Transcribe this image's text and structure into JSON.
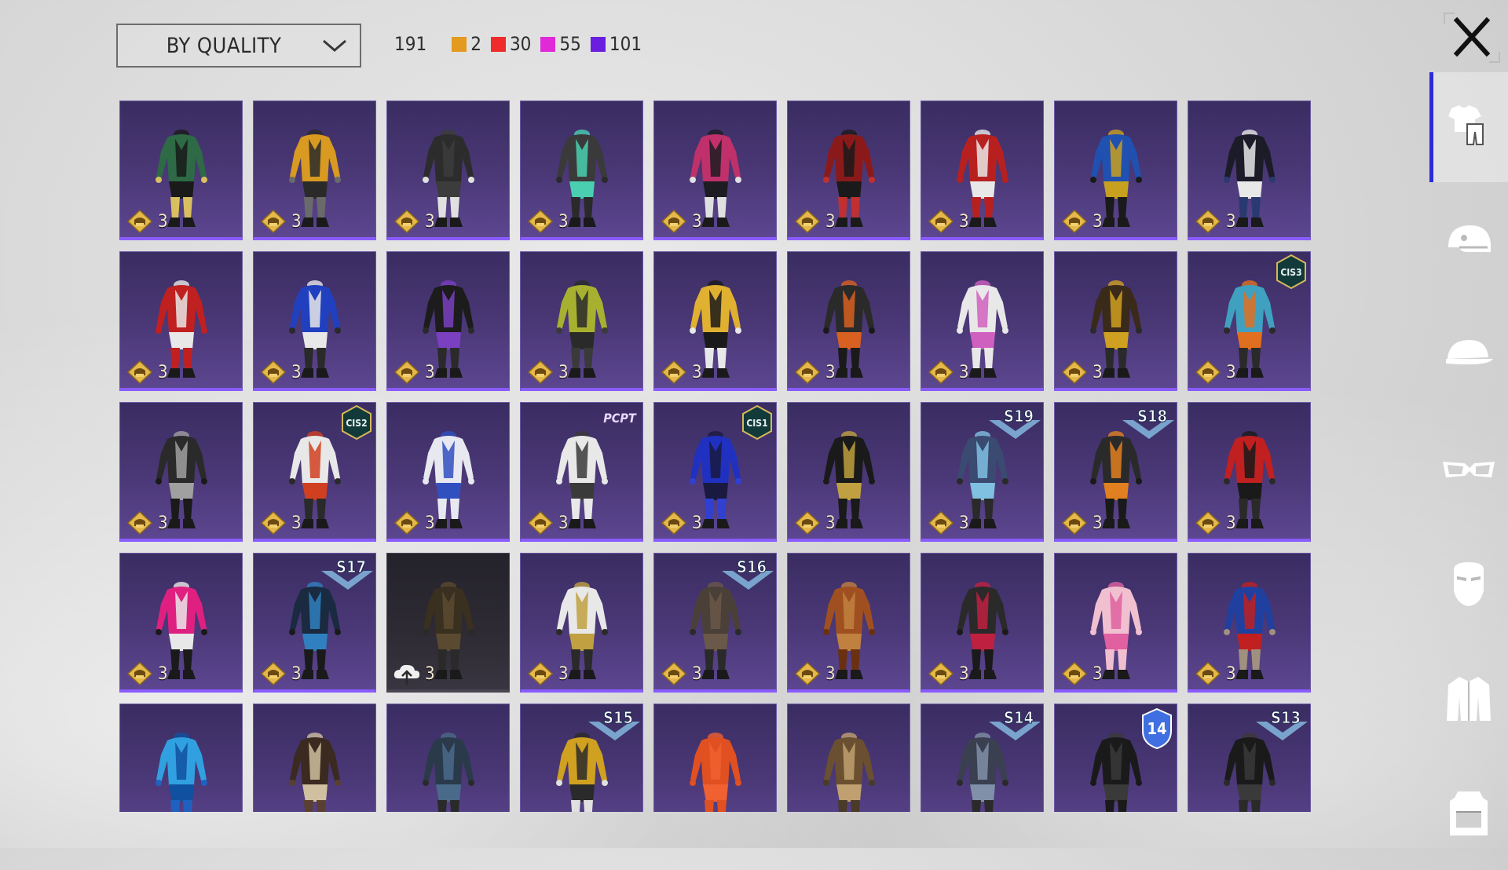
{
  "sort": {
    "label": "BY QUALITY",
    "icon": "chevron-down-icon"
  },
  "counts": {
    "total": "191",
    "groups": [
      {
        "color": "#e39a1e",
        "count": "2"
      },
      {
        "color": "#ef2b2b",
        "count": "30"
      },
      {
        "color": "#e02ad8",
        "count": "55"
      },
      {
        "color": "#6a1ee0",
        "count": "101"
      }
    ]
  },
  "close": {
    "icon": "close-icon"
  },
  "sidebar": [
    {
      "icon": "outfit-icon",
      "active": true
    },
    {
      "icon": "helmet-icon"
    },
    {
      "icon": "cap-icon"
    },
    {
      "icon": "goggles-icon"
    },
    {
      "icon": "mask-icon"
    },
    {
      "icon": "jacket-icon"
    },
    {
      "icon": "backpack-icon"
    }
  ],
  "items": [
    {
      "qty": "3",
      "palette": [
        "#2d6a45",
        "#1a1a1a",
        "#d8c060"
      ]
    },
    {
      "qty": "3",
      "palette": [
        "#d89a20",
        "#2a2a2a",
        "#6a6a6a"
      ]
    },
    {
      "qty": "3",
      "palette": [
        "#2c2c2c",
        "#3c3c3c",
        "#e0e0e0"
      ]
    },
    {
      "qty": "3",
      "palette": [
        "#3a3a3a",
        "#4ad0b0",
        "#2a2a2a"
      ]
    },
    {
      "qty": "3",
      "palette": [
        "#c0306a",
        "#1c1c22",
        "#e0e0e0"
      ]
    },
    {
      "qty": "3",
      "palette": [
        "#8a1a1a",
        "#1a1a1a",
        "#c03030"
      ]
    },
    {
      "qty": "3",
      "palette": [
        "#b82020",
        "#e8e8e8",
        "#b82020"
      ]
    },
    {
      "qty": "3",
      "palette": [
        "#2050b0",
        "#c8a020",
        "#1a1a1a"
      ]
    },
    {
      "qty": "3",
      "palette": [
        "#1c1c28",
        "#e8e8e8",
        "#2a3a70"
      ]
    },
    {
      "qty": "3",
      "palette": [
        "#c02020",
        "#e8e8e8",
        "#c02020"
      ]
    },
    {
      "qty": "3",
      "palette": [
        "#2040c0",
        "#e8e8e8",
        "#2a2a2a"
      ]
    },
    {
      "qty": "3",
      "palette": [
        "#1c1c1c",
        "#7a40c0",
        "#2a2a2a"
      ]
    },
    {
      "qty": "3",
      "palette": [
        "#a8b030",
        "#2a2a2a",
        "#3a3a3a"
      ]
    },
    {
      "qty": "3",
      "palette": [
        "#e0b030",
        "#1a1a1a",
        "#e8e8e8"
      ]
    },
    {
      "qty": "3",
      "palette": [
        "#2a2a2a",
        "#d86020",
        "#1a1a1a"
      ]
    },
    {
      "qty": "3",
      "palette": [
        "#e8e8e8",
        "#d060c0",
        "#e8e8e8"
      ]
    },
    {
      "qty": "3",
      "palette": [
        "#3a2a1a",
        "#d0a020",
        "#2a2a2a"
      ]
    },
    {
      "qty": "3",
      "palette": [
        "#40a0c0",
        "#e07020",
        "#2a2a2a"
      ],
      "badge": {
        "type": "hex",
        "text": "CIS3"
      }
    },
    {
      "qty": "3",
      "palette": [
        "#2a2a2a",
        "#a0a0a0",
        "#1a1a1a"
      ]
    },
    {
      "qty": "3",
      "palette": [
        "#e8e8e8",
        "#d04020",
        "#2a2a2a"
      ],
      "badge": {
        "type": "hex",
        "text": "CIS2"
      }
    },
    {
      "qty": "3",
      "palette": [
        "#e8e8f0",
        "#3050c0",
        "#e8e8f0"
      ]
    },
    {
      "qty": "3",
      "palette": [
        "#e8e8e8",
        "#3a3a3a",
        "#e8e8e8"
      ],
      "badge": {
        "type": "logo",
        "text": "PCPT"
      }
    },
    {
      "qty": "3",
      "palette": [
        "#2030c0",
        "#1a1a40",
        "#3040d0"
      ],
      "badge": {
        "type": "hex",
        "text": "CIS1"
      }
    },
    {
      "qty": "3",
      "palette": [
        "#1a1a1a",
        "#c0a040",
        "#1a1a1a"
      ]
    },
    {
      "qty": "3",
      "palette": [
        "#3a4a70",
        "#80c0e0",
        "#2a2a2a"
      ],
      "badge": {
        "type": "season",
        "text": "S19"
      }
    },
    {
      "qty": "3",
      "palette": [
        "#2a2a2a",
        "#e08020",
        "#1a1a1a"
      ],
      "badge": {
        "type": "season",
        "text": "S18"
      }
    },
    {
      "qty": "3",
      "palette": [
        "#c02020",
        "#1a1a1a",
        "#2a2a2a"
      ]
    },
    {
      "qty": "3",
      "palette": [
        "#e02080",
        "#e8e8e8",
        "#1a1a1a"
      ]
    },
    {
      "qty": "3",
      "palette": [
        "#1a2a40",
        "#3080c0",
        "#1a1a1a"
      ],
      "badge": {
        "type": "season",
        "text": "S17"
      }
    },
    {
      "qty": "3",
      "palette": [
        "#3a3020",
        "#5a4a30",
        "#2a2a2a"
      ],
      "dark": true,
      "icon": "cloud-upload-icon"
    },
    {
      "qty": "3",
      "palette": [
        "#e8e8e8",
        "#c0a040",
        "#2a2a2a"
      ]
    },
    {
      "qty": "3",
      "palette": [
        "#4a4038",
        "#6a5848",
        "#2a2a2a"
      ],
      "badge": {
        "type": "season",
        "text": "S16"
      }
    },
    {
      "qty": "3",
      "palette": [
        "#a05020",
        "#c08040",
        "#6a3010"
      ]
    },
    {
      "qty": "3",
      "palette": [
        "#2a2a2a",
        "#c02040",
        "#1a1a1a"
      ]
    },
    {
      "qty": "3",
      "palette": [
        "#f0c0d0",
        "#e060a0",
        "#f0c0d0"
      ]
    },
    {
      "qty": "3",
      "palette": [
        "#2040a0",
        "#c02020",
        "#a09080"
      ]
    },
    {
      "qty": "",
      "palette": [
        "#30a0e0",
        "#1050a0",
        "#2060c0"
      ]
    },
    {
      "qty": "",
      "palette": [
        "#3a2a20",
        "#d0c0a0",
        "#5a4030"
      ]
    },
    {
      "qty": "",
      "palette": [
        "#2a3a4a",
        "#4a6a8a",
        "#2a2a2a"
      ]
    },
    {
      "qty": "",
      "palette": [
        "#d0a020",
        "#2a2a2a",
        "#e0e0e0"
      ],
      "badge": {
        "type": "season",
        "text": "S15"
      }
    },
    {
      "qty": "",
      "palette": [
        "#e05020",
        "#f06030",
        "#e05020"
      ]
    },
    {
      "qty": "",
      "palette": [
        "#6a5030",
        "#c0a070",
        "#4a3a28"
      ]
    },
    {
      "qty": "",
      "palette": [
        "#3a4050",
        "#8090a8",
        "#2a2a2a"
      ],
      "badge": {
        "type": "season",
        "text": "S14"
      }
    },
    {
      "qty": "",
      "palette": [
        "#1a1a1a",
        "#3a3a3a",
        "#1a1a1a"
      ],
      "badge": {
        "type": "shield",
        "text": "14"
      }
    },
    {
      "qty": "",
      "palette": [
        "#1a1a1a",
        "#3a3a3a",
        "#2a2a2a"
      ],
      "badge": {
        "type": "season",
        "text": "S13"
      }
    }
  ]
}
